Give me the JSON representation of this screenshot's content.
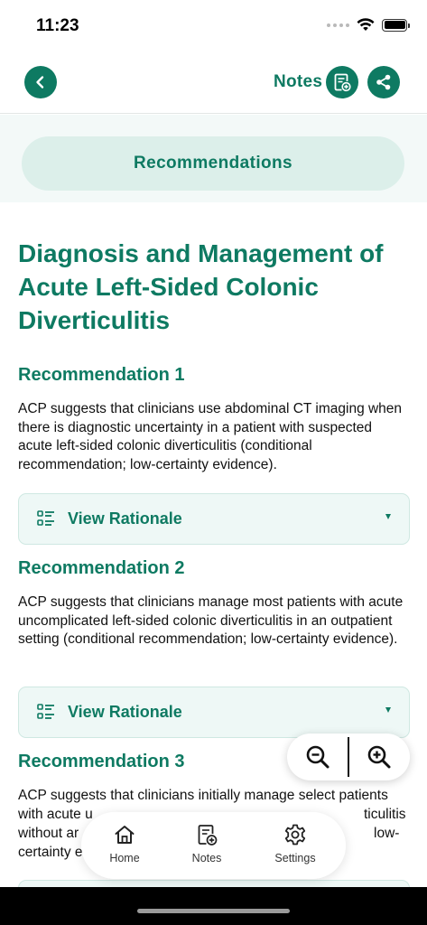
{
  "status_bar": {
    "time": "11:23"
  },
  "nav": {
    "notes_label": "Notes"
  },
  "tab": {
    "label": "Recommendations"
  },
  "page": {
    "title": "Diagnosis and Management of Acute Left-Sided Colonic Diverticulitis"
  },
  "recommendations": [
    {
      "heading": "Recommendation 1",
      "text": "ACP suggests that clinicians use abdominal CT imaging when there is diagnostic uncertainty in a patient with suspected acute left-sided colonic diverticulitis (conditional recommendation; low-certainty evidence).",
      "rationale_label": "View Rationale"
    },
    {
      "heading": "Recommendation 2",
      "text": "ACP suggests that clinicians manage most patients with acute uncomplicated left-sided colonic diverticulitis in an outpatient setting (conditional recommendation; low-certainty evidence).",
      "rationale_label": "View Rationale"
    },
    {
      "heading": "Recommendation 3",
      "text_lines": [
        "ACP suggests that clinicians initially manage select patients",
        "with acute u",
        "ticulitis",
        "without ar",
        "low-",
        "certainty e"
      ]
    }
  ],
  "bottom_nav": {
    "home": "Home",
    "notes": "Notes",
    "settings": "Settings"
  },
  "icons": {
    "back": "chevron-left-icon",
    "notes": "add-note-icon",
    "share": "share-icon",
    "rationale": "list-icon",
    "zoom_out": "zoom-out-icon",
    "zoom_in": "zoom-in-icon",
    "home": "home-icon",
    "settings": "gear-icon"
  },
  "colors": {
    "accent": "#0e7a62",
    "pill": "#dcefea",
    "band": "#f3f9f8",
    "card": "#eef8f6"
  }
}
